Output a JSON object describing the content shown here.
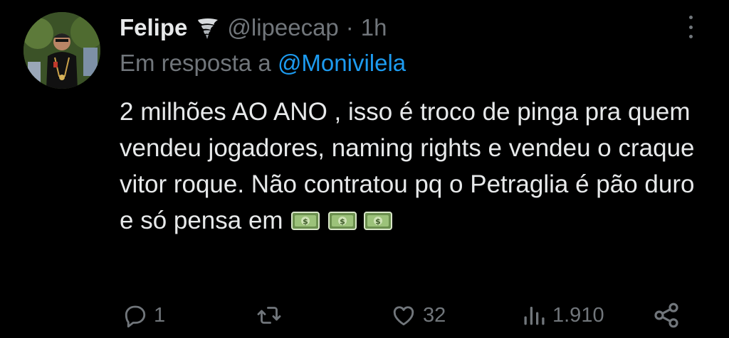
{
  "author": {
    "display_name": "Felipe",
    "badge_icon": "tornado-icon",
    "handle": "@lipeecap",
    "separator": "·",
    "time": "1h"
  },
  "reply_to": {
    "prefix": "Em resposta a",
    "mention": "@Monivilela"
  },
  "tweet": {
    "text": "2 milhões AO ANO , isso é troco de pinga pra quem vendeu jogadores, naming rights e vendeu o craque vitor roque. Não contratou pq o Petraglia é pão duro e só pensa em",
    "trailing_icons": [
      "money-icon",
      "money-icon",
      "money-icon"
    ]
  },
  "actions": {
    "reply_count": "1",
    "retweet_count": "",
    "like_count": "32",
    "view_count": "1.910"
  },
  "colors": {
    "background": "#000000",
    "text": "#e7e9ea",
    "muted": "#71767b",
    "link": "#1d9bf0"
  }
}
